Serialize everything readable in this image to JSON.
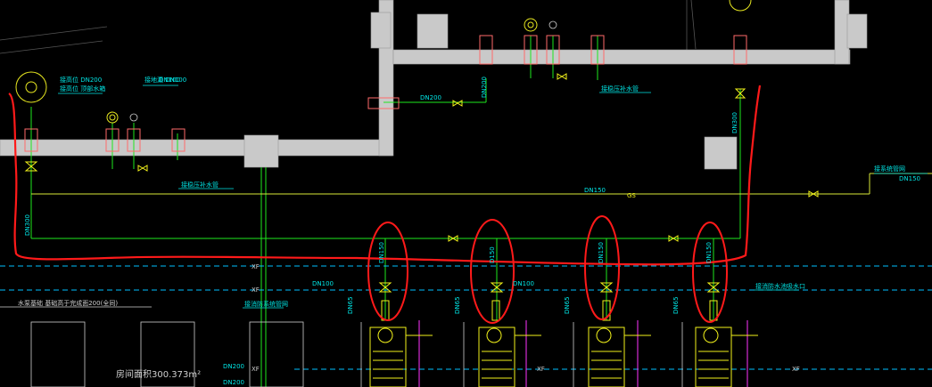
{
  "drawing": {
    "labels": {
      "dn200_top": "DN200",
      "dn200_mid": "DN200",
      "dn300_right": "DN300",
      "dn150_main": "DN150",
      "gs": "GS",
      "dn150_right": "DN150",
      "dn300_left": "DN300",
      "dn100_left": "DN100",
      "dn100_top": "DN100",
      "xf1": "XF",
      "xf2": "XF",
      "xf3": "XF",
      "xf4": "XF",
      "xf5": "XF",
      "dn100_mid": "DN100",
      "dn65_1": "DN65",
      "dn65_2": "DN65",
      "dn65_3": "DN65",
      "dn65_4": "DN65",
      "dn150_p1": "DN150",
      "dn150_p2": "D150",
      "dn150_p3": "DN150",
      "dn150_p4": "DN150",
      "dn200_bot1": "DN200",
      "dn200_bot2": "DN200",
      "area": "房间面积300.373m²",
      "note_pump": "水泵基础 基础高于完成面200(全同)",
      "note_top_left": "接高位 DN200",
      "note_top_left2": "接高位 顶部水箱",
      "note_top_mid": "接地漏 DN100",
      "note_supply": "接稳压补水管",
      "note_supply2": "接稳压补水管",
      "note_right": "接消防水池吸水口",
      "note_right2": "接系统管网",
      "note_pump2": "接消防系统管网"
    }
  }
}
